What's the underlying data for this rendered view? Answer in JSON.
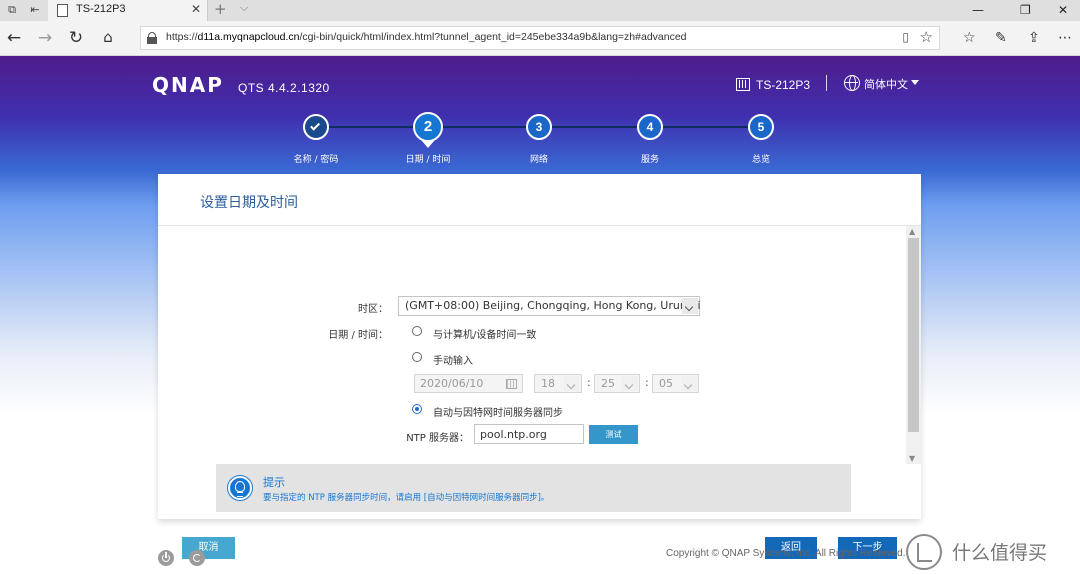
{
  "browser": {
    "tab_title": "TS-212P3",
    "new_tab_glyph": "+",
    "url_prefix": "https://",
    "url_host": "d11a.myqnapcloud.cn",
    "url_rest": "/cgi-bin/quick/html/index.html?tunnel_agent_id=245ebe334a9b&lang=zh#advanced"
  },
  "header": {
    "logo": "QNAP",
    "version": "QTS 4.4.2.1320",
    "device_name": "TS-212P3",
    "language": "简体中文"
  },
  "steps": [
    {
      "label": "名称 / 密码",
      "number": "",
      "state": "done"
    },
    {
      "label": "日期 / 时间",
      "number": "2",
      "state": "active"
    },
    {
      "label": "网络",
      "number": "3",
      "state": "pending"
    },
    {
      "label": "服务",
      "number": "4",
      "state": "pending"
    },
    {
      "label": "总览",
      "number": "5",
      "state": "pending"
    }
  ],
  "dialog": {
    "title": "设置日期及时间",
    "timezone_label": "时区：",
    "timezone_value": "(GMT+08:00) Beijing, Chongqing, Hong Kong, Urumqi",
    "datetime_label": "日期 / 时间：",
    "option_sync_pc": "与计算机/设备时间一致",
    "option_manual": "手动输入",
    "date_value": "2020/06/10",
    "hour_value": "18",
    "minute_value": "25",
    "second_value": "05",
    "time_colon": ":",
    "option_ntp": "自动与因特网时间服务器同步",
    "ntp_label": "NTP 服务器：",
    "ntp_value": "pool.ntp.org",
    "test_button": "测试",
    "selected_option": "ntp"
  },
  "tip": {
    "title": "提示",
    "text": "要与指定的 NTP 服务器同步时间，请启用 [自动与因特网时间服务器同步]。"
  },
  "buttons": {
    "cancel": "取消",
    "back": "返回",
    "next": "下一步"
  },
  "footer": {
    "copyright": "Copyright © QNAP Systems, Inc. All Rights Reserved.",
    "watermark": "什么值得买"
  },
  "colors": {
    "accent": "#1677d2",
    "primary_button": "#1468b8",
    "cancel_button": "#46a8d0"
  }
}
